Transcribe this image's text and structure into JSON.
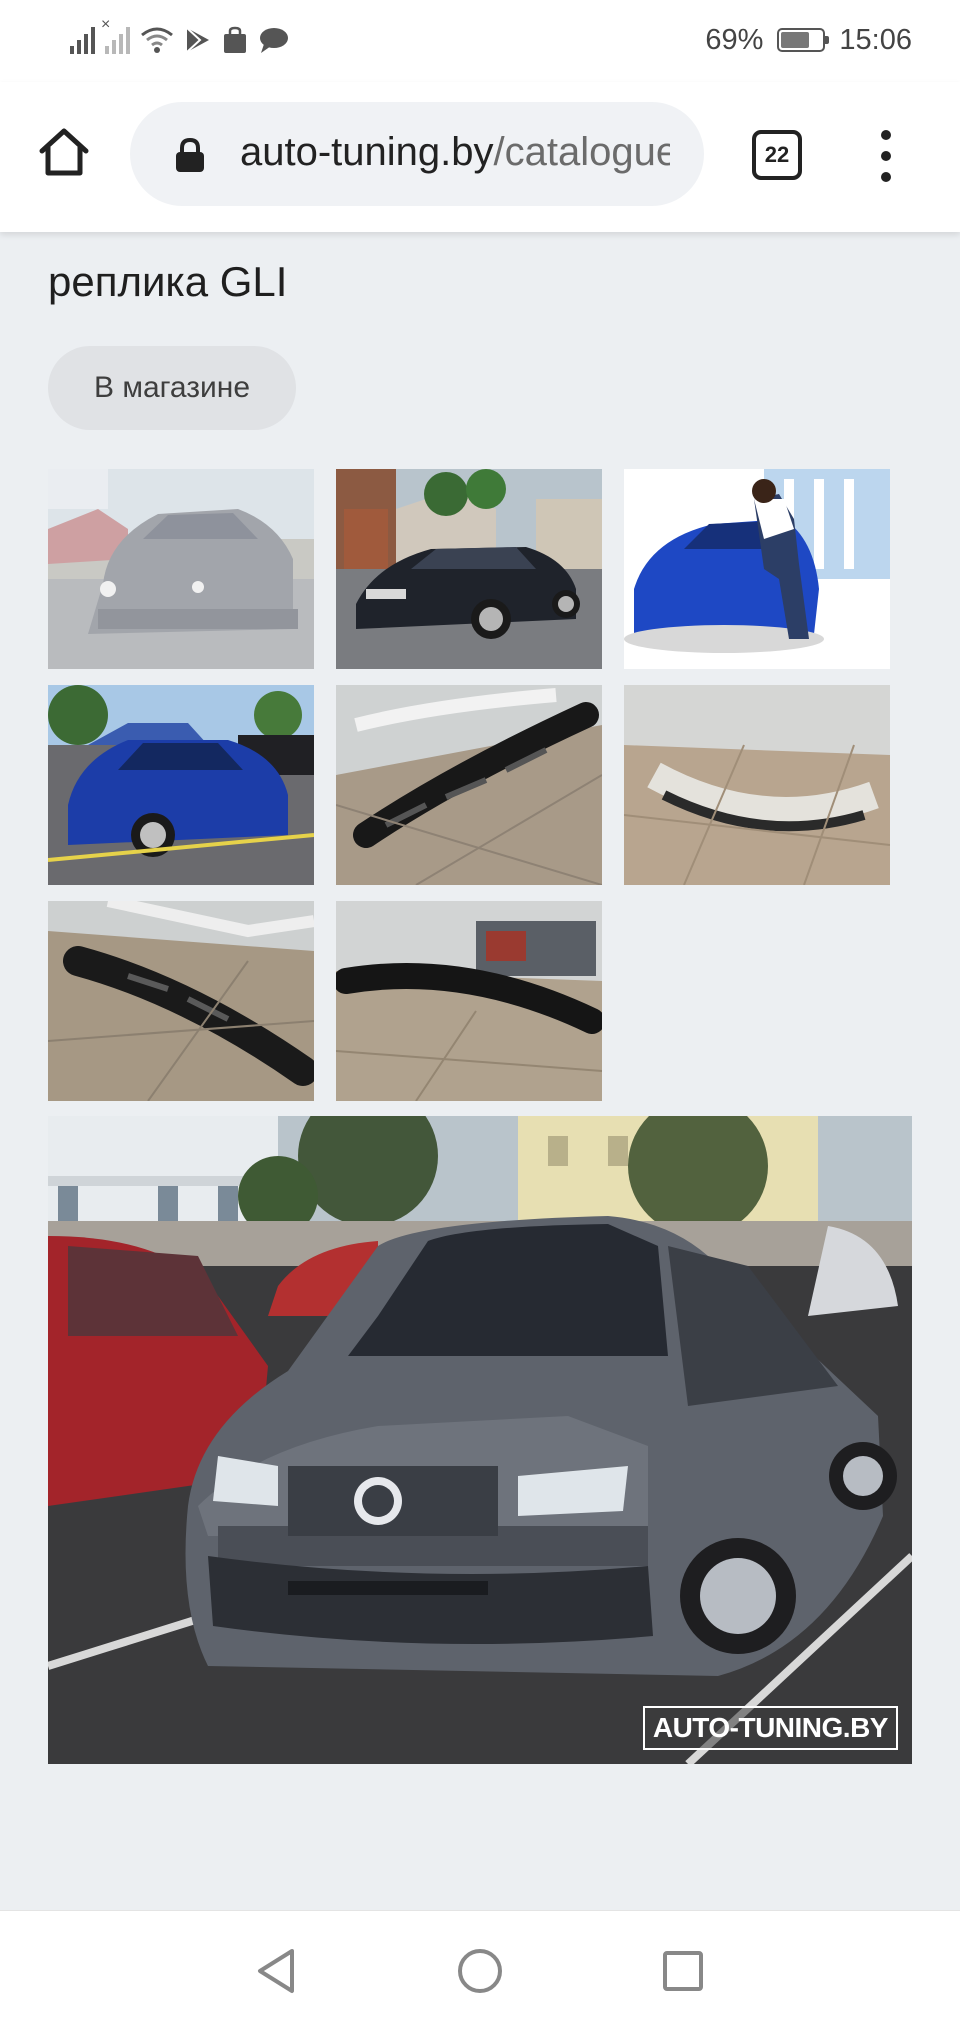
{
  "status_bar": {
    "battery_percent": "69%",
    "battery_level": 0.69,
    "time": "15:06",
    "icons": [
      "signal-icon",
      "signal-off-icon",
      "wifi-icon",
      "play-store-icon",
      "bag-icon",
      "message-icon"
    ]
  },
  "browser": {
    "url_domain": "auto-tuning.by",
    "url_path": "/catalogue",
    "tab_count": "22"
  },
  "page": {
    "title": "реплика GLI",
    "shop_chip": "В магазине"
  },
  "gallery": {
    "thumbnails": [
      {
        "name": "thumb-grey-jetta-front"
      },
      {
        "name": "thumb-black-jetta-driveway"
      },
      {
        "name": "thumb-blue-jetta-model"
      },
      {
        "name": "thumb-blue-jetta-carshow"
      },
      {
        "name": "thumb-lip-side"
      },
      {
        "name": "thumb-lip-top"
      },
      {
        "name": "thumb-lip-angle"
      },
      {
        "name": "thumb-lip-front"
      }
    ],
    "main_watermark": "AUTO-TUNING.BY"
  },
  "colors": {
    "page_bg": "#eceff2",
    "chip_bg": "#e0e2e5",
    "toolbar_bg": "#ffffff"
  }
}
